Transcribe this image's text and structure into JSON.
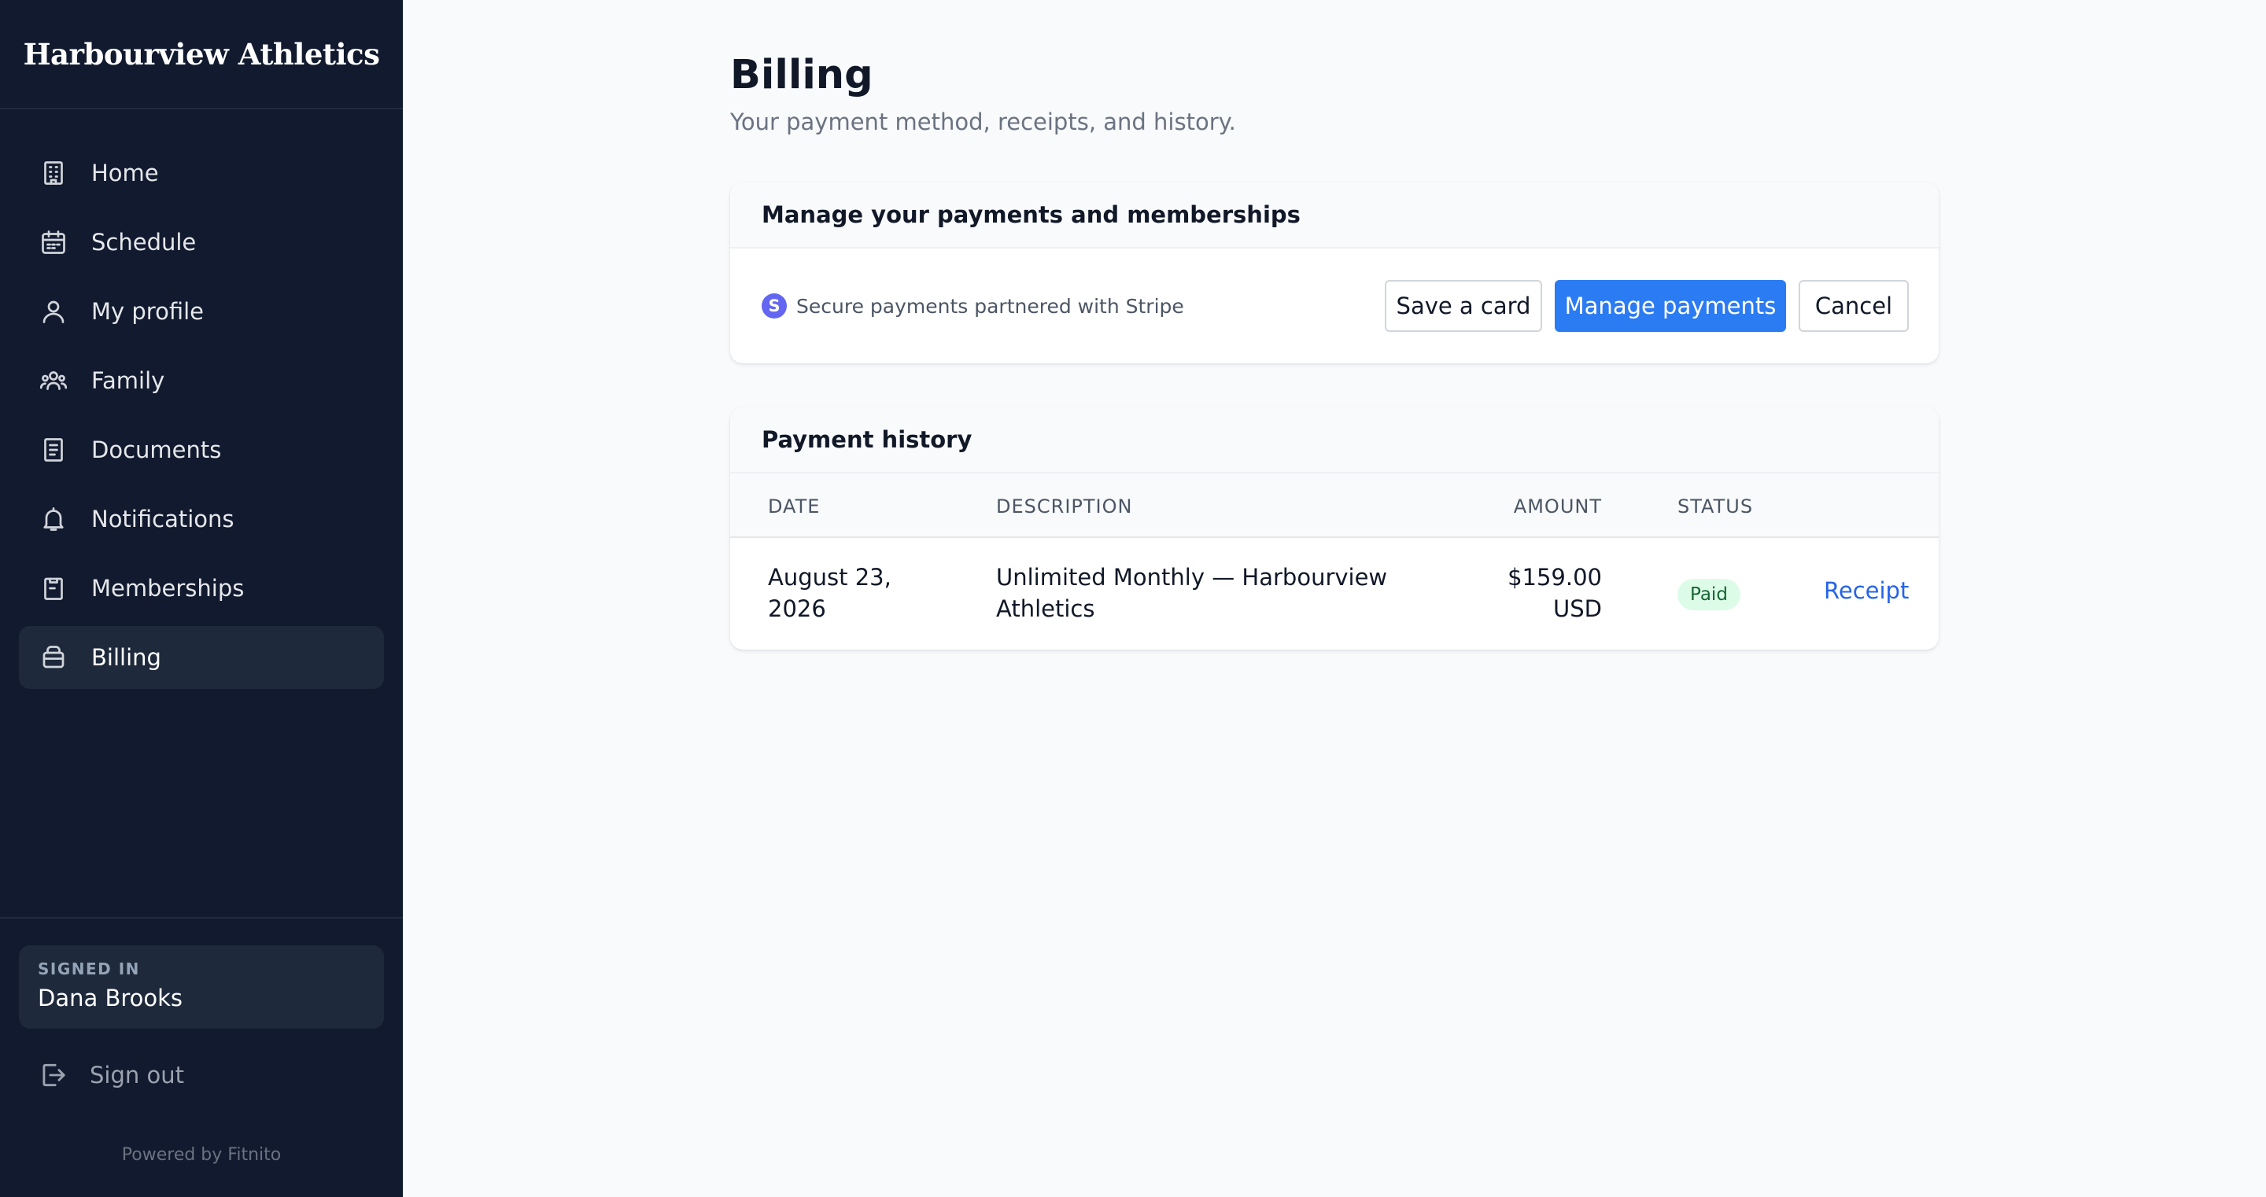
{
  "brand": {
    "name": "Harbourview Athletics"
  },
  "sidebar": {
    "items": [
      {
        "label": "Home",
        "icon": "building-icon",
        "active": false
      },
      {
        "label": "Schedule",
        "icon": "calendar-icon",
        "active": false
      },
      {
        "label": "My profile",
        "icon": "user-icon",
        "active": false
      },
      {
        "label": "Family",
        "icon": "users-icon",
        "active": false
      },
      {
        "label": "Documents",
        "icon": "document-icon",
        "active": false
      },
      {
        "label": "Notifications",
        "icon": "bell-icon",
        "active": false
      },
      {
        "label": "Memberships",
        "icon": "clipboard-icon",
        "active": false
      },
      {
        "label": "Billing",
        "icon": "wallet-icon",
        "active": true
      }
    ],
    "signed_in_label": "SIGNED IN",
    "user_name": "Dana Brooks",
    "sign_out_label": "Sign out",
    "powered_by": "Powered by Fitnito"
  },
  "page": {
    "title": "Billing",
    "subtitle": "Your payment method, receipts, and history."
  },
  "payments_card": {
    "title": "Manage your payments and memberships",
    "stripe_badge": "S",
    "stripe_note": "Secure payments partnered with Stripe",
    "save_card_label": "Save a card",
    "manage_payments_label": "Manage payments",
    "cancel_label": "Cancel"
  },
  "history_card": {
    "title": "Payment history",
    "columns": [
      "DATE",
      "DESCRIPTION",
      "AMOUNT",
      "STATUS"
    ],
    "rows": [
      {
        "date": "August 23, 2026",
        "description": "Unlimited Monthly — Harbourview Athletics",
        "amount": "$159.00 USD",
        "status": "Paid",
        "action": "Receipt"
      }
    ]
  },
  "colors": {
    "sidebar_bg": "#111a2e",
    "active_item_bg": "#1e293b",
    "primary": "#2b7bf2",
    "link": "#2563eb",
    "paid_bg": "#dcfce7",
    "paid_text": "#166534",
    "stripe": "#6366f1"
  }
}
